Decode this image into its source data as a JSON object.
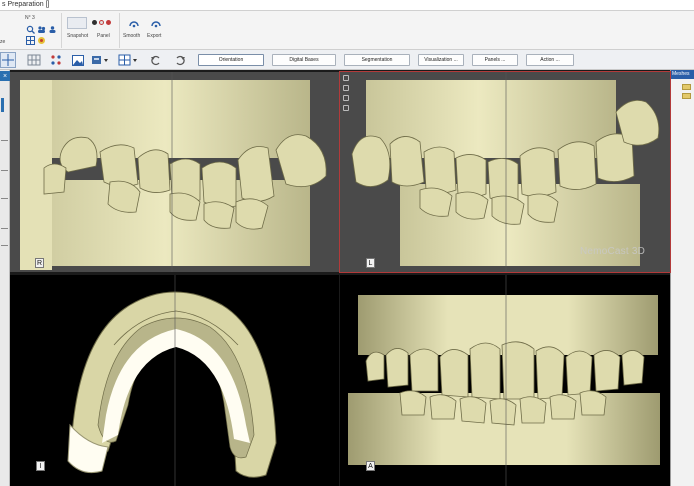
{
  "window": {
    "title": "s Preparation []"
  },
  "ribbon": {
    "undo_label": "N° 3",
    "left_label": "ze",
    "snapshot_label": "Snapshot",
    "panel_label": "Panel",
    "smooth_label": "Smooth",
    "export_label": "Export"
  },
  "toolbar": {
    "buttons": [
      {
        "label": "Orientation"
      },
      {
        "label": "Digital Bases"
      },
      {
        "label": "Segmentation"
      },
      {
        "label": "Visualization ..."
      },
      {
        "label": "Panels ..."
      },
      {
        "label": "Action ..."
      }
    ]
  },
  "right_panel": {
    "title": "Meshes"
  },
  "views": {
    "right": {
      "label": "R"
    },
    "left": {
      "label": "L",
      "watermark": "NemoCast 3D"
    },
    "inferior": {
      "label": "I"
    },
    "anterior": {
      "label": "A"
    }
  },
  "colors": {
    "model": "#e0dcb0",
    "model_shadow": "#8a8760",
    "accent": "#2a5ea8"
  }
}
